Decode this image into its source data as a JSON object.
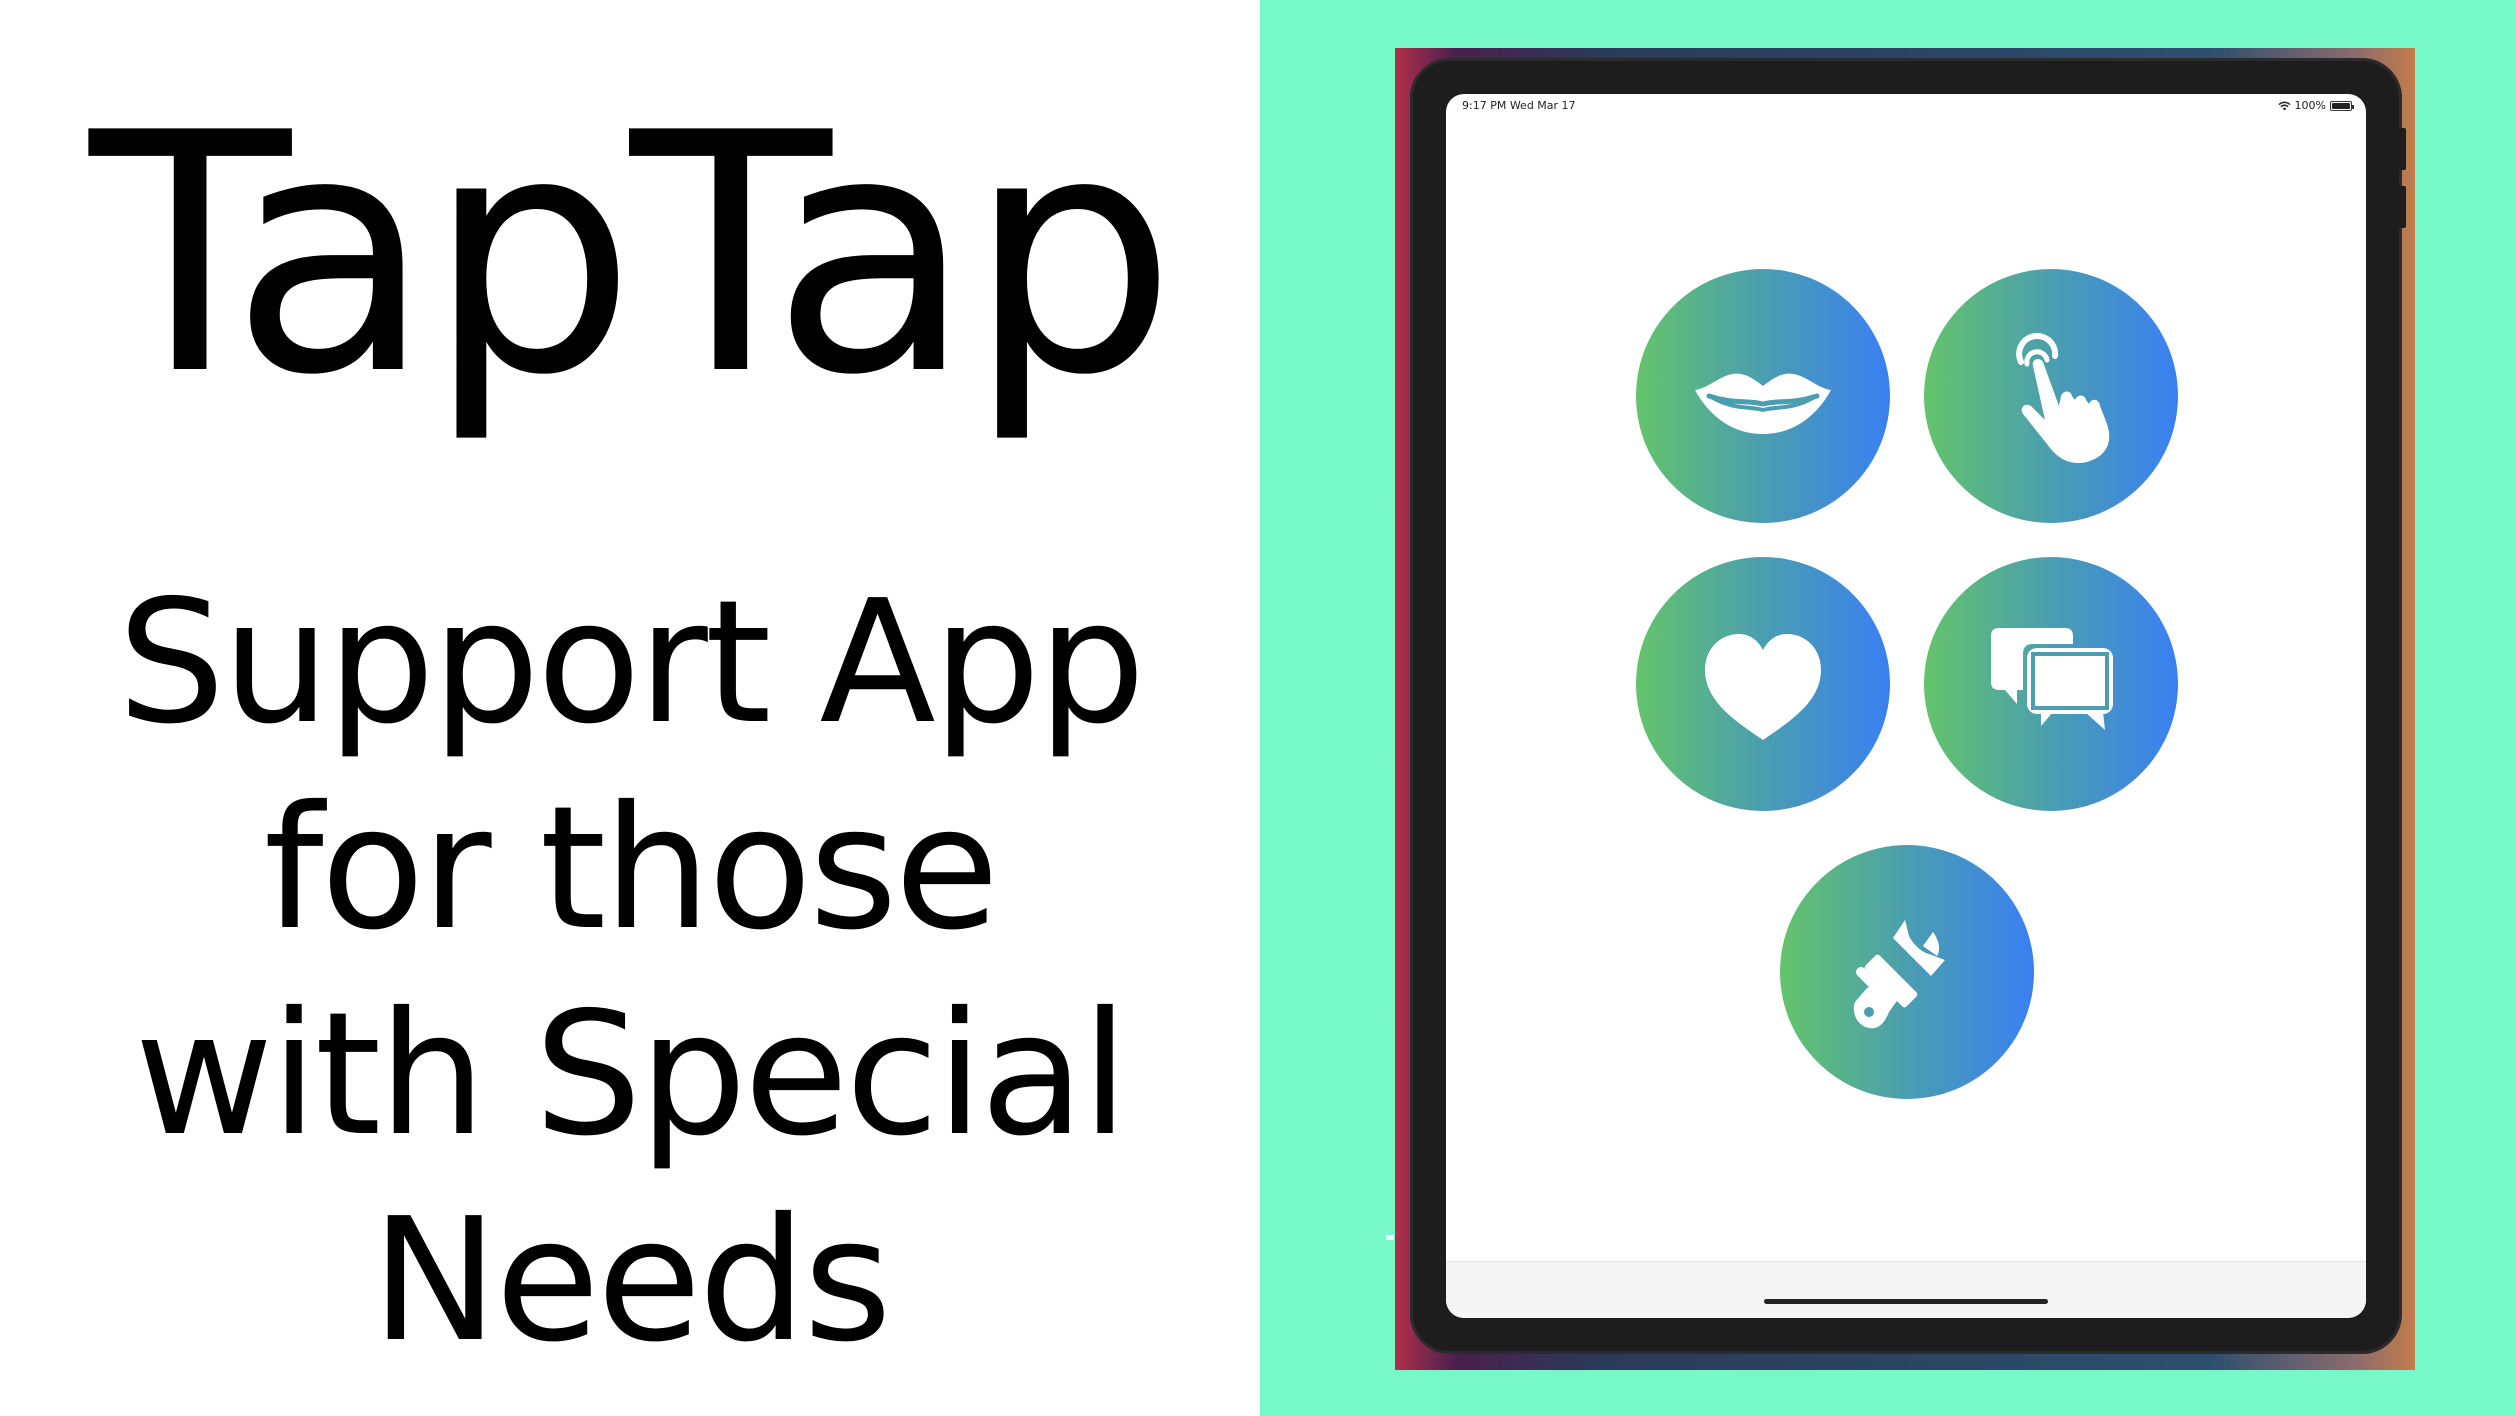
{
  "promo": {
    "title": "TapTap",
    "tagline_lines": [
      "Support App",
      "for those",
      "with Special",
      "Needs"
    ]
  },
  "status_bar": {
    "time": "9:17 PM   Wed Mar 17",
    "battery": "100%"
  },
  "buttons": [
    {
      "id": "speak",
      "icon": "lips-icon"
    },
    {
      "id": "tap",
      "icon": "tap-hand-icon"
    },
    {
      "id": "favorites",
      "icon": "heart-icon"
    },
    {
      "id": "chat",
      "icon": "speech-bubbles-icon"
    },
    {
      "id": "customize",
      "icon": "paintbrush-icon"
    }
  ],
  "colors": {
    "background_mint": "#77f8c9",
    "gradient_start": "#64c46a",
    "gradient_end": "#3a80f2",
    "device_frame": "#1d1d1d"
  }
}
